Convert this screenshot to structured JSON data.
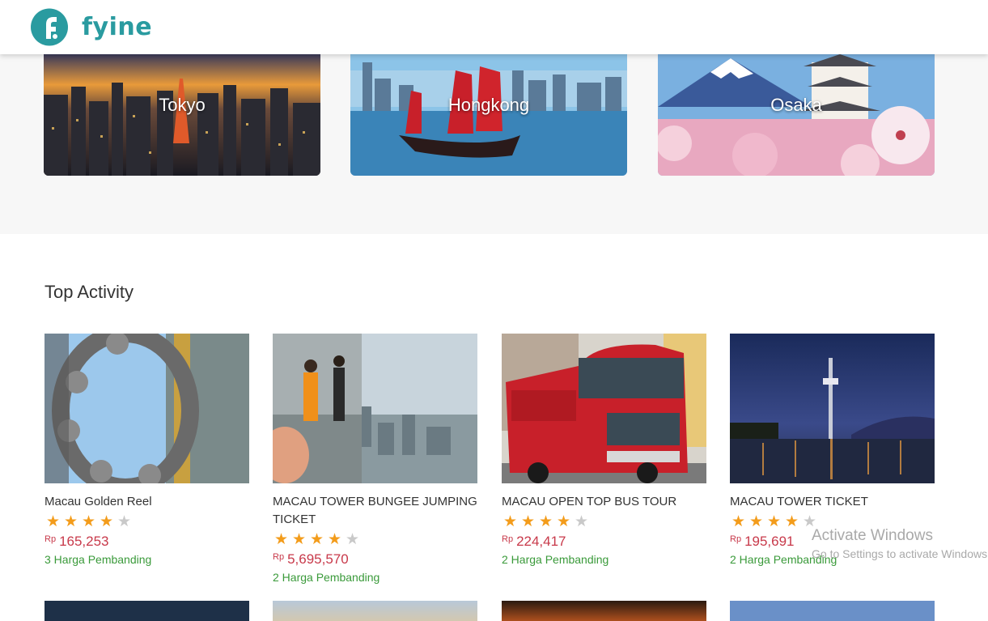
{
  "header": {
    "brand": "fyine",
    "brand_color": "#2a9ba0"
  },
  "destinations": [
    {
      "name": "Tokyo"
    },
    {
      "name": "Hongkong"
    },
    {
      "name": "Osaka"
    }
  ],
  "top_activity": {
    "title": "Top Activity",
    "items": [
      {
        "title": "Macau Golden Reel",
        "rating": 4,
        "currency": "Rp",
        "price": "165,253",
        "compare": "3 Harga Pembanding"
      },
      {
        "title": "MACAU TOWER BUNGEE JUMPING TICKET",
        "rating": 4,
        "currency": "Rp",
        "price": "5,695,570",
        "compare": "2 Harga Pembanding"
      },
      {
        "title": "MACAU OPEN TOP BUS TOUR",
        "rating": 4,
        "currency": "Rp",
        "price": "224,417",
        "compare": "2 Harga Pembanding"
      },
      {
        "title": "MACAU TOWER TICKET",
        "rating": 4,
        "currency": "Rp",
        "price": "195,691",
        "compare": "2 Harga Pembanding"
      }
    ]
  },
  "watermark": {
    "line1": "Activate Windows",
    "line2": "Go to Settings to activate Windows."
  },
  "colors": {
    "price": "#c8394a",
    "compare": "#3a9a3a",
    "star_on": "#f39c1b",
    "star_off": "#c9c9c9"
  }
}
